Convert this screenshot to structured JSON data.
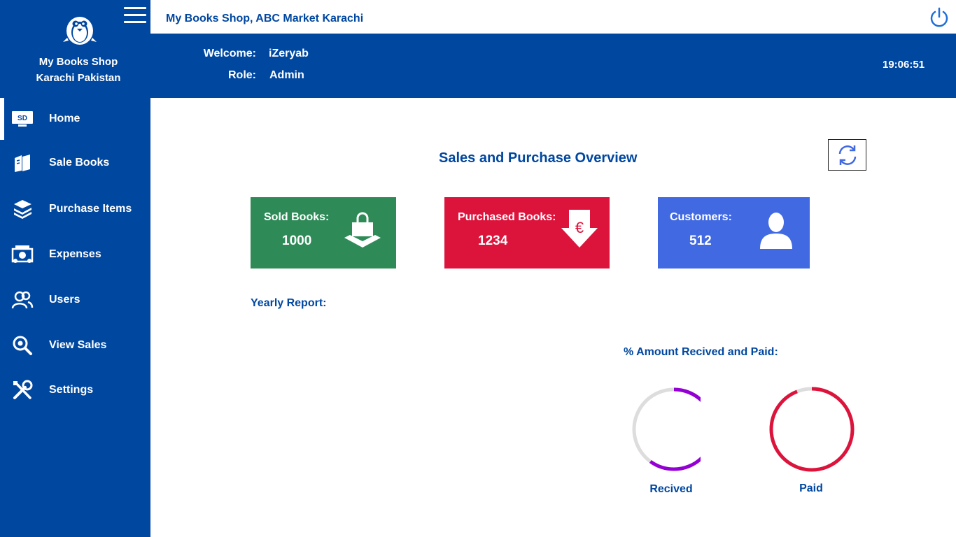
{
  "sidebar": {
    "shop_line1": "My Books Shop",
    "shop_line2": "Karachi Pakistan",
    "items": [
      {
        "label": "Home",
        "icon": "monitor-icon",
        "active": true
      },
      {
        "label": "Sale Books",
        "icon": "books-icon"
      },
      {
        "label": "Purchase Items",
        "icon": "stacked-books-icon"
      },
      {
        "label": "Expenses",
        "icon": "money-icon"
      },
      {
        "label": "Users",
        "icon": "users-icon"
      },
      {
        "label": "View Sales",
        "icon": "search-icon"
      },
      {
        "label": "Settings",
        "icon": "tools-icon"
      }
    ],
    "home_icon_text": "SD"
  },
  "topbar": {
    "title": "My Books Shop, ABC Market Karachi"
  },
  "header": {
    "welcome_label": "Welcome:",
    "welcome_value": "iZeryab",
    "role_label": "Role:",
    "role_value": "Admin",
    "clock": "19:06:51"
  },
  "main": {
    "title": "Sales and Purchase Overview",
    "cards": [
      {
        "label": "Sold Books:",
        "value": "1000",
        "color": "#2e8b57",
        "icon": "shopping-bag-icon"
      },
      {
        "label": "Purchased Books:",
        "value": "1234",
        "color": "#dc143c",
        "icon": "euro-down-icon"
      },
      {
        "label": "Customers:",
        "value": "512",
        "color": "#4169e1",
        "icon": "user-icon"
      }
    ],
    "yearly_report_label": "Yearly Report:",
    "amount_label": "% Amount Recived and Paid:",
    "rings": [
      {
        "label": "Recived",
        "fraction": 0.6,
        "color": "#9400d3"
      },
      {
        "label": "Paid",
        "fraction": 0.94,
        "color": "#dc143c"
      }
    ]
  }
}
